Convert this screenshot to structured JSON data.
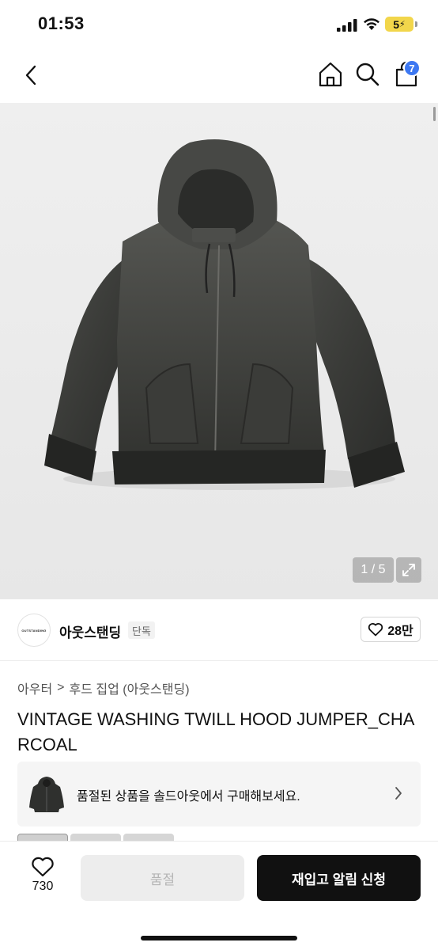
{
  "status_bar": {
    "time": "01:53",
    "battery": "5"
  },
  "nav": {
    "cart_count": "7"
  },
  "gallery": {
    "counter": "1 / 5"
  },
  "brand": {
    "logo_text": "OUTSTANDING",
    "name": "아웃스탠딩",
    "tag": "단독",
    "likes": "28만"
  },
  "breadcrumb": {
    "category": "아우터",
    "separator": ">",
    "subcategory": "후드 집업 (아웃스탠딩)"
  },
  "product": {
    "title": "VINTAGE WASHING TWILL HOOD JUMPER_CHARCOAL"
  },
  "soldout_banner": {
    "text": "품절된 상품을 솔드아웃에서 구매해보세요."
  },
  "bottom_bar": {
    "wish_count": "730",
    "soldout_label": "품절",
    "restock_label": "재입고 알림 신청"
  },
  "colors": {
    "accent_badge": "#3d78f2",
    "primary_button": "#111111",
    "battery": "#f2d64b"
  }
}
